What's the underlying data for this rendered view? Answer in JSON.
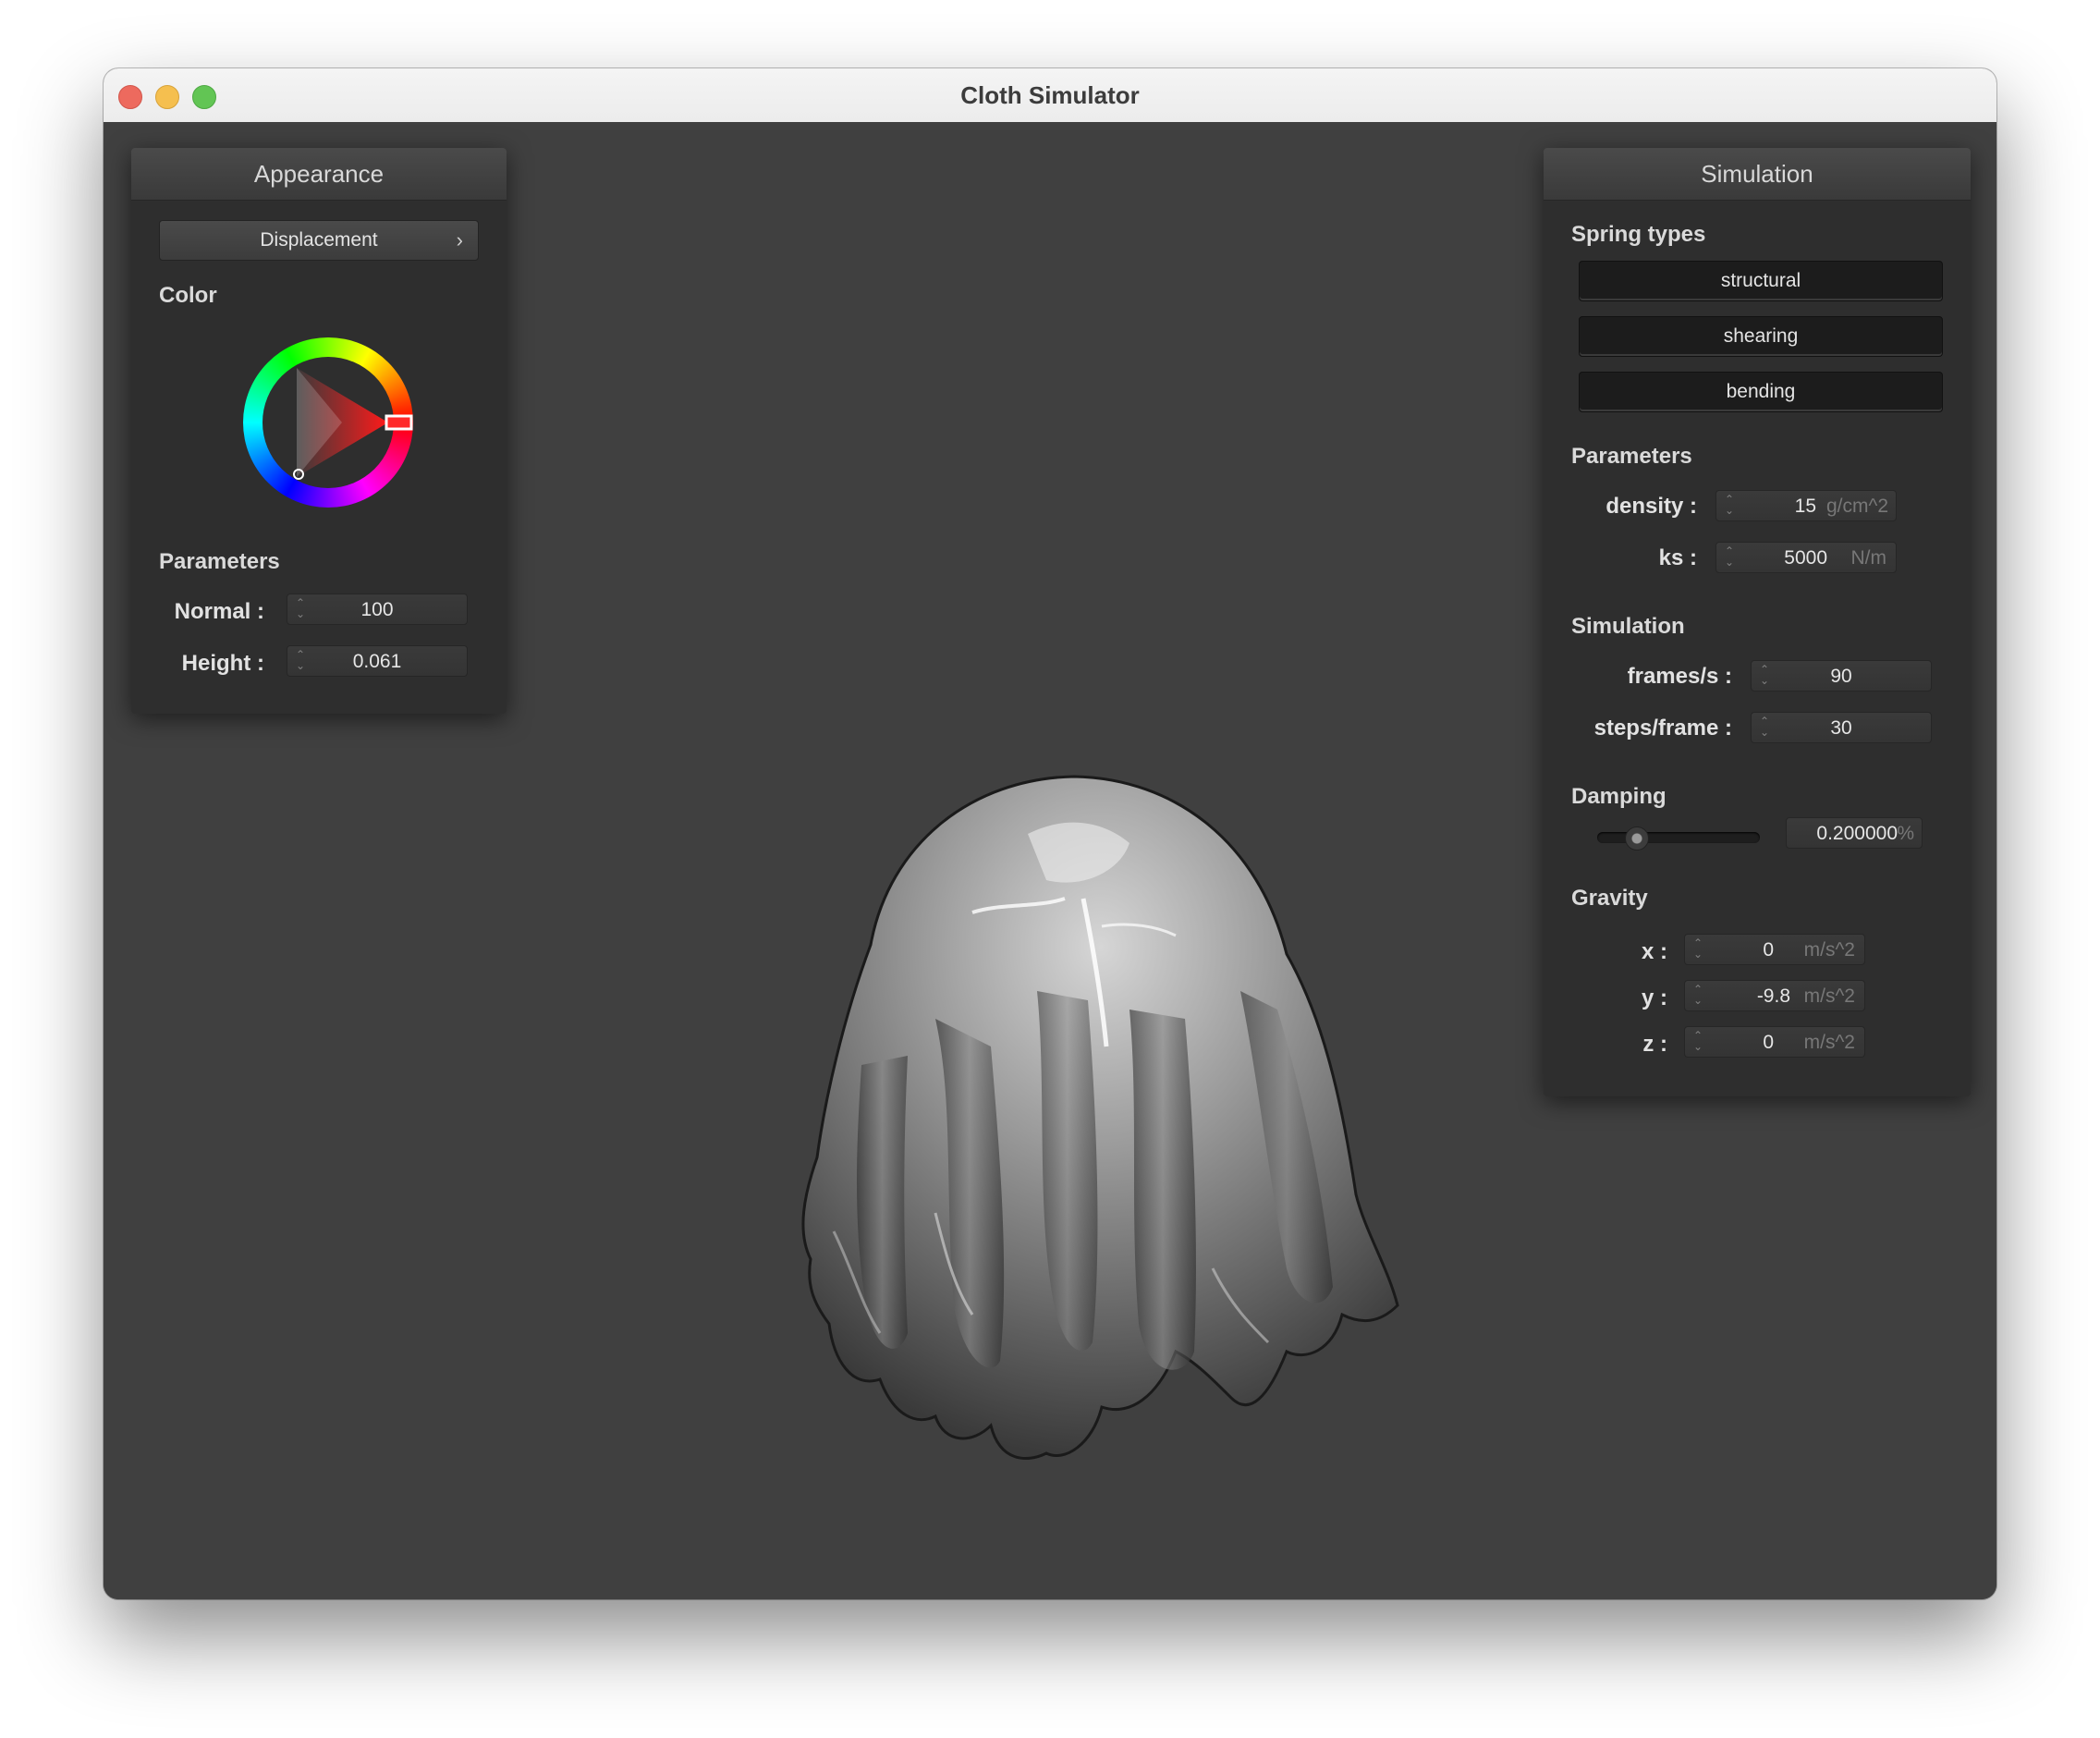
{
  "window": {
    "title": "Cloth Simulator"
  },
  "appearance": {
    "title": "Appearance",
    "shader_select": "Displacement",
    "color_label": "Color",
    "selected_color": "#ff1a1a",
    "params_label": "Parameters",
    "normal": {
      "label": "Normal :",
      "value": "100"
    },
    "height": {
      "label": "Height :",
      "value": "0.061"
    }
  },
  "simulation_panel": {
    "title": "Simulation",
    "spring_types_label": "Spring types",
    "spring_types": [
      "structural",
      "shearing",
      "bending"
    ],
    "params_label": "Parameters",
    "density": {
      "label": "density :",
      "value": "15",
      "unit": "g/cm^2"
    },
    "ks": {
      "label": "ks :",
      "value": "5000",
      "unit": "N/m"
    },
    "sim_label": "Simulation",
    "fps": {
      "label": "frames/s :",
      "value": "90"
    },
    "steps": {
      "label": "steps/frame :",
      "value": "30"
    },
    "damping_label": "Damping",
    "damping": {
      "value": "0.200000",
      "unit": "%",
      "fraction": 0.2
    },
    "gravity_label": "Gravity",
    "gravity": [
      {
        "label": "x :",
        "value": "0",
        "unit": "m/s^2"
      },
      {
        "label": "y :",
        "value": "-9.8",
        "unit": "m/s^2"
      },
      {
        "label": "z :",
        "value": "0",
        "unit": "m/s^2"
      }
    ]
  },
  "colors": {
    "viewport_bg": "#404040",
    "panel_bg": "#2e2e2e"
  }
}
